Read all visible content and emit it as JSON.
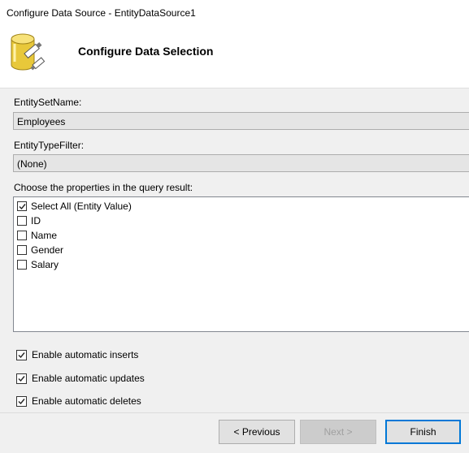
{
  "window": {
    "title": "Configure Data Source - EntityDataSource1"
  },
  "header": {
    "heading": "Configure Data Selection",
    "icon": "database-icon"
  },
  "entity_set": {
    "label": "EntitySetName:",
    "value": "Employees"
  },
  "entity_type": {
    "label": "EntityTypeFilter:",
    "value": "(None)"
  },
  "properties": {
    "label": "Choose the properties in the query result:",
    "items": [
      {
        "label": "Select All (Entity Value)",
        "checked": true
      },
      {
        "label": "ID",
        "checked": false
      },
      {
        "label": "Name",
        "checked": false
      },
      {
        "label": "Gender",
        "checked": false
      },
      {
        "label": "Salary",
        "checked": false
      }
    ]
  },
  "options": [
    {
      "label": "Enable automatic inserts",
      "checked": true
    },
    {
      "label": "Enable automatic updates",
      "checked": true
    },
    {
      "label": "Enable automatic deletes",
      "checked": true
    }
  ],
  "buttons": {
    "previous": "< Previous",
    "next": "Next >",
    "finish": "Finish"
  },
  "colors": {
    "accent": "#0078d7"
  }
}
